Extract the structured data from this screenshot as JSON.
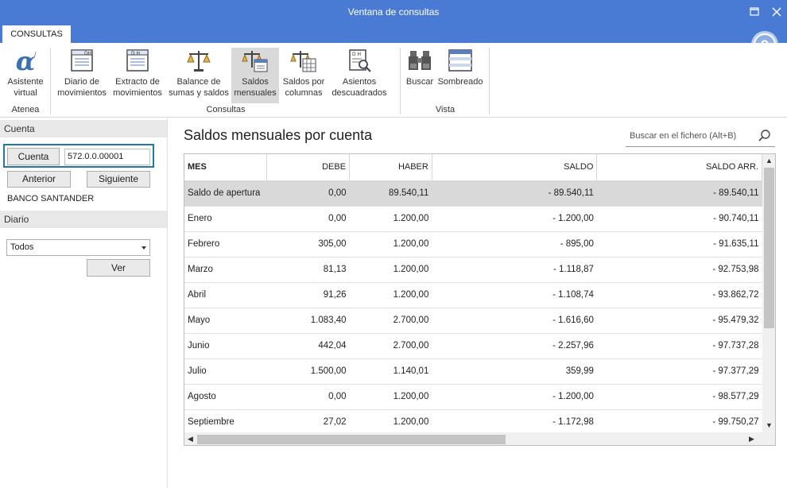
{
  "window": {
    "title": "Ventana de consultas"
  },
  "ribbon": {
    "tab": "CONSULTAS",
    "groups": [
      {
        "label": "Atenea"
      },
      {
        "label": "Consultas"
      },
      {
        "label": "Vista"
      }
    ],
    "buttons": [
      {
        "line1": "Asistente",
        "line2": "virtual"
      },
      {
        "line1": "Diario de",
        "line2": "movimientos"
      },
      {
        "line1": "Extracto de",
        "line2": "movimientos"
      },
      {
        "line1": "Balance de",
        "line2": "sumas y saldos"
      },
      {
        "line1": "Saldos",
        "line2": "mensuales"
      },
      {
        "line1": "Saldos por",
        "line2": "columnas"
      },
      {
        "line1": "Asientos",
        "line2": "descuadrados"
      },
      {
        "line1": "Buscar",
        "line2": ""
      },
      {
        "line1": "Sombreado",
        "line2": ""
      }
    ]
  },
  "left": {
    "cuenta_header": "Cuenta",
    "cuenta_button": "Cuenta",
    "cuenta_value": "572.0.0.00001",
    "anterior": "Anterior",
    "siguiente": "Siguiente",
    "bank": "BANCO SANTANDER",
    "diario_header": "Diario",
    "diario_value": "Todos",
    "ver": "Ver"
  },
  "main": {
    "title": "Saldos mensuales por cuenta",
    "search_placeholder": "Buscar en el fichero (Alt+B)",
    "columns": [
      "MES",
      "DEBE",
      "HABER",
      "SALDO",
      "SALDO ARR."
    ],
    "rows": [
      [
        "Saldo de apertura",
        "0,00",
        "89.540,11",
        "- 89.540,11",
        "- 89.540,11"
      ],
      [
        "Enero",
        "0,00",
        "1.200,00",
        "- 1.200,00",
        "- 90.740,11"
      ],
      [
        "Febrero",
        "305,00",
        "1.200,00",
        "- 895,00",
        "- 91.635,11"
      ],
      [
        "Marzo",
        "81,13",
        "1.200,00",
        "- 1.118,87",
        "- 92.753,98"
      ],
      [
        "Abril",
        "91,26",
        "1.200,00",
        "- 1.108,74",
        "- 93.862,72"
      ],
      [
        "Mayo",
        "1.083,40",
        "2.700,00",
        "- 1.616,60",
        "- 95.479,32"
      ],
      [
        "Junio",
        "442,04",
        "2.700,00",
        "- 2.257,96",
        "- 97.737,28"
      ],
      [
        "Julio",
        "1.500,00",
        "1.140,01",
        "359,99",
        "- 97.377,29"
      ],
      [
        "Agosto",
        "0,00",
        "1.200,00",
        "- 1.200,00",
        "- 98.577,29"
      ],
      [
        "Septiembre",
        "27,02",
        "1.200,00",
        "- 1.172,98",
        "- 99.750,27"
      ]
    ]
  },
  "icons": {
    "atenea": "alpha-icon",
    "help": "help-icon",
    "search": "search-icon"
  },
  "colors": {
    "titlebar": "#4a7bd4",
    "selection": "#d9d9d9",
    "focus_border": "#1f7a9c",
    "alpha": "#3d6fb5"
  }
}
